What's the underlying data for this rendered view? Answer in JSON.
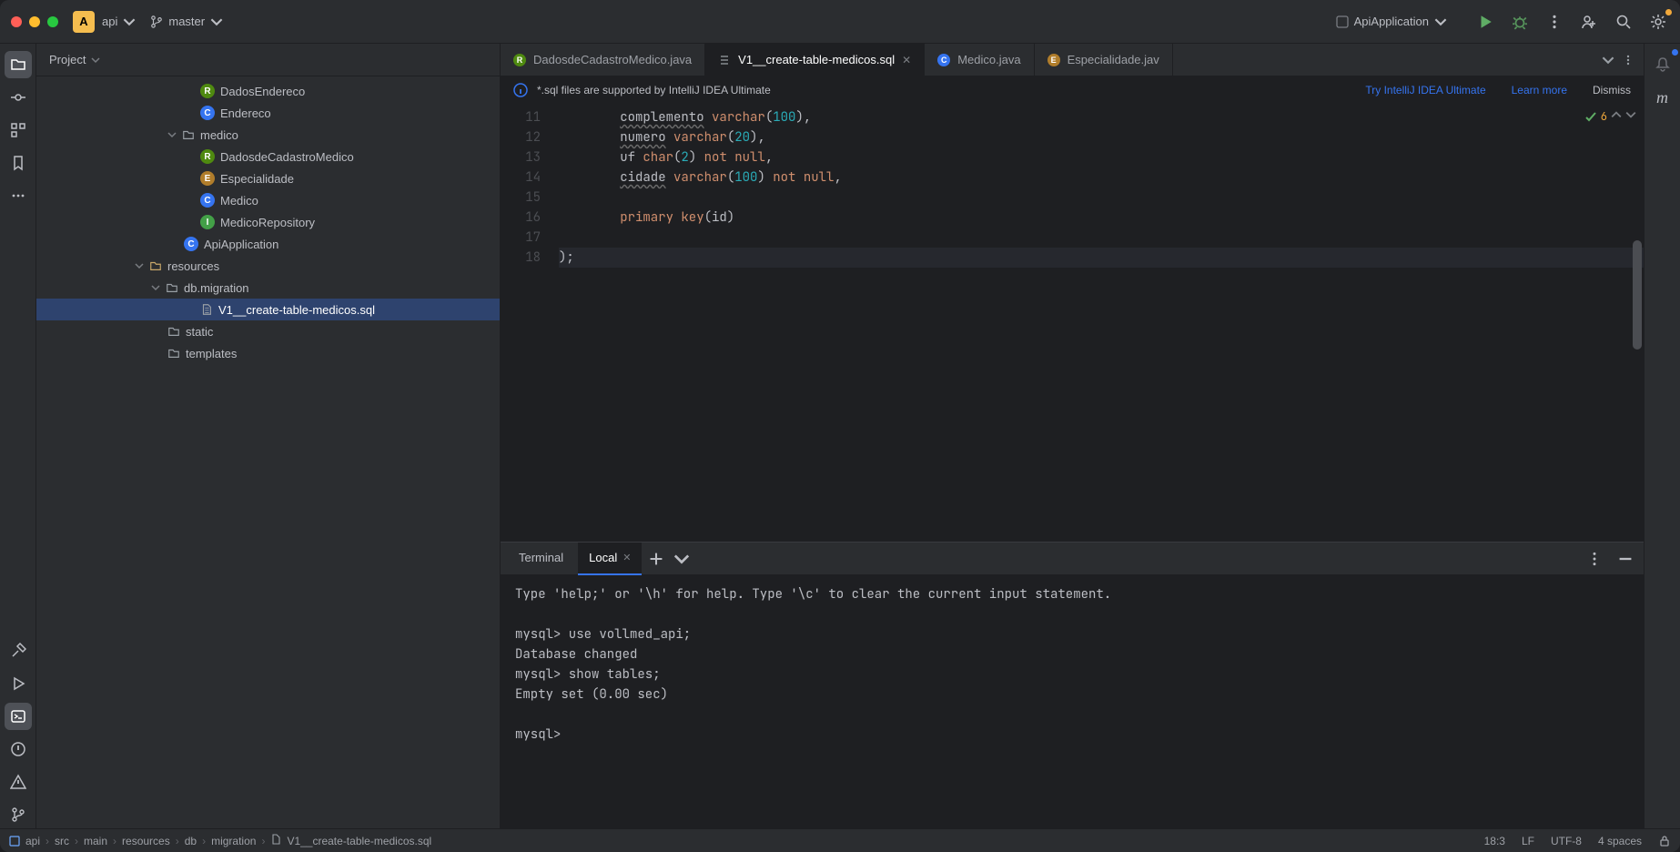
{
  "titlebar": {
    "project_letter": "A",
    "project_name": "api",
    "branch": "master",
    "run_config": "ApiApplication"
  },
  "sidebar": {
    "header": "Project",
    "tree": [
      {
        "indent": 10,
        "badge": "R",
        "label": "DadosEndereco"
      },
      {
        "indent": 10,
        "badge": "C",
        "label": "Endereco"
      },
      {
        "indent": 8,
        "chevron": "down",
        "folder": true,
        "label": "medico"
      },
      {
        "indent": 10,
        "badge": "R",
        "label": "DadosdeCadastroMedico"
      },
      {
        "indent": 10,
        "badge": "E",
        "label": "Especialidade"
      },
      {
        "indent": 10,
        "badge": "C",
        "label": "Medico"
      },
      {
        "indent": 10,
        "badge": "I",
        "label": "MedicoRepository"
      },
      {
        "indent": 9,
        "badge": "C",
        "label": "ApiApplication"
      },
      {
        "indent": 6,
        "chevron": "down",
        "folder": true,
        "resources": true,
        "label": "resources"
      },
      {
        "indent": 7,
        "chevron": "down",
        "folder": true,
        "label": "db.migration"
      },
      {
        "indent": 10,
        "file": true,
        "label": "V1__create-table-medicos.sql",
        "selected": true
      },
      {
        "indent": 8,
        "folder": true,
        "label": "static"
      },
      {
        "indent": 8,
        "folder": true,
        "label": "templates"
      }
    ]
  },
  "tabs": [
    {
      "badge": "R",
      "label": "DadosdeCadastroMedico.java",
      "active": false,
      "closeable": false
    },
    {
      "text_icon": true,
      "label": "V1__create-table-medicos.sql",
      "active": true,
      "closeable": true
    },
    {
      "badge": "C",
      "label": "Medico.java",
      "active": false,
      "closeable": false
    },
    {
      "badge": "E",
      "label": "Especialidade.jav",
      "active": false,
      "closeable": false
    }
  ],
  "banner": {
    "message": "*.sql files are supported by IntelliJ IDEA Ultimate",
    "try_link": "Try IntelliJ IDEA Ultimate",
    "learn_link": "Learn more",
    "dismiss": "Dismiss"
  },
  "editor": {
    "first_line": 11,
    "caret_line_index": 7,
    "problems_count": "6",
    "lines": [
      {
        "n": 11,
        "segs": [
          {
            "t": "        ",
            "c": "id"
          },
          {
            "t": "complemento",
            "c": "id",
            "wavy": true
          },
          {
            "t": " ",
            "c": "id"
          },
          {
            "t": "varchar",
            "c": "key"
          },
          {
            "t": "(",
            "c": "id"
          },
          {
            "t": "100",
            "c": "num"
          },
          {
            "t": "),",
            "c": "id"
          }
        ]
      },
      {
        "n": 12,
        "segs": [
          {
            "t": "        ",
            "c": "id"
          },
          {
            "t": "numero",
            "c": "id",
            "wavy": true
          },
          {
            "t": " ",
            "c": "id"
          },
          {
            "t": "varchar",
            "c": "key"
          },
          {
            "t": "(",
            "c": "id"
          },
          {
            "t": "20",
            "c": "num"
          },
          {
            "t": "),",
            "c": "id"
          }
        ]
      },
      {
        "n": 13,
        "segs": [
          {
            "t": "        ",
            "c": "id"
          },
          {
            "t": "uf ",
            "c": "id"
          },
          {
            "t": "char",
            "c": "key"
          },
          {
            "t": "(",
            "c": "id"
          },
          {
            "t": "2",
            "c": "num"
          },
          {
            "t": ") ",
            "c": "id"
          },
          {
            "t": "not null",
            "c": "key"
          },
          {
            "t": ",",
            "c": "id"
          }
        ]
      },
      {
        "n": 14,
        "segs": [
          {
            "t": "        ",
            "c": "id"
          },
          {
            "t": "cidade",
            "c": "id",
            "wavy": true
          },
          {
            "t": " ",
            "c": "id"
          },
          {
            "t": "varchar",
            "c": "key"
          },
          {
            "t": "(",
            "c": "id"
          },
          {
            "t": "100",
            "c": "num"
          },
          {
            "t": ") ",
            "c": "id"
          },
          {
            "t": "not null",
            "c": "key"
          },
          {
            "t": ",",
            "c": "id"
          }
        ]
      },
      {
        "n": 15,
        "segs": [
          {
            "t": "",
            "c": "id"
          }
        ]
      },
      {
        "n": 16,
        "segs": [
          {
            "t": "        ",
            "c": "id"
          },
          {
            "t": "primary key",
            "c": "key"
          },
          {
            "t": "(id)",
            "c": "id"
          }
        ]
      },
      {
        "n": 17,
        "segs": [
          {
            "t": "",
            "c": "id"
          }
        ]
      },
      {
        "n": 18,
        "segs": [
          {
            "t": ");",
            "c": "id"
          }
        ]
      }
    ]
  },
  "bottom_panel": {
    "tabs": {
      "terminal": "Terminal",
      "local": "Local"
    },
    "lines": [
      "Type 'help;' or '\\h' for help. Type '\\c' to clear the current input statement.",
      "",
      "mysql> use vollmed_api;",
      "Database changed",
      "mysql> show tables;",
      "Empty set (0.00 sec)",
      "",
      "mysql>"
    ]
  },
  "breadcrumbs": [
    "api",
    "src",
    "main",
    "resources",
    "db",
    "migration",
    "V1__create-table-medicos.sql"
  ],
  "status": {
    "caret": "18:3",
    "line_sep": "LF",
    "encoding": "UTF-8",
    "indent": "4 spaces"
  }
}
